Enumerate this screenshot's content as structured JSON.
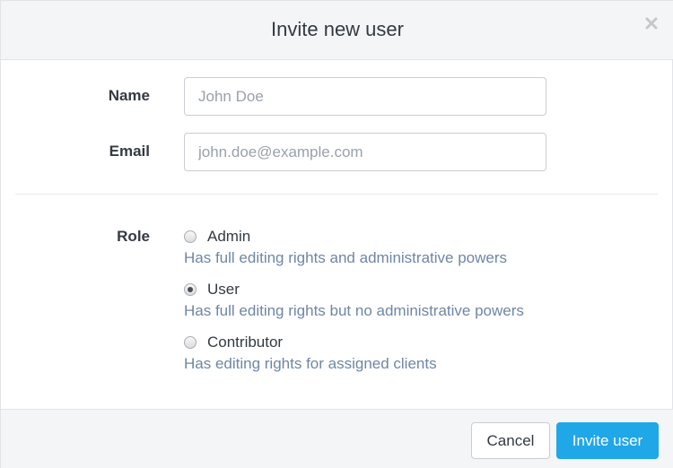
{
  "dialog": {
    "title": "Invite new user",
    "close_icon": "close-icon"
  },
  "form": {
    "name": {
      "label": "Name",
      "value": "",
      "placeholder": "John Doe"
    },
    "email": {
      "label": "Email",
      "value": "",
      "placeholder": "john.doe@example.com"
    },
    "role": {
      "label": "Role",
      "selected": "User",
      "options": [
        {
          "label": "Admin",
          "description": "Has full editing rights and administrative powers",
          "checked": false
        },
        {
          "label": "User",
          "description": "Has full editing rights but no administrative powers",
          "checked": true
        },
        {
          "label": "Contributor",
          "description": "Has editing rights for assigned clients",
          "checked": false
        }
      ]
    }
  },
  "footer": {
    "cancel_label": "Cancel",
    "submit_label": "Invite user"
  },
  "colors": {
    "primary": "#1fa7e8",
    "description_text": "#6f86a6",
    "header_bg": "#f4f5f7"
  }
}
